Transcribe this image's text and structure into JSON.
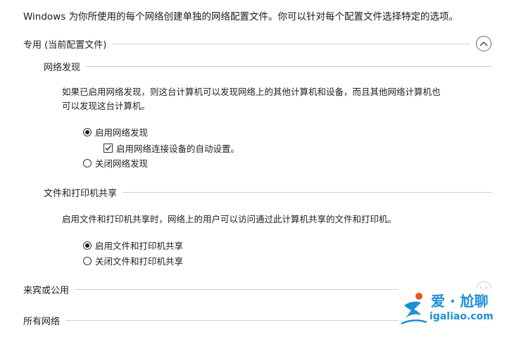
{
  "intro_text": "Windows 为你所使用的每个网络创建单独的网络配置文件。你可以针对每个配置文件选择特定的选项。",
  "profiles": {
    "private": {
      "title": "专用 (当前配置文件)",
      "expanded": true,
      "network_discovery": {
        "title": "网络发现",
        "description_line1": "如果已启用网络发现，则这台计算机可以发现网络上的其他计算机和设备，而且其他网络计算机也",
        "description_line2": "可以发现这台计算机。",
        "option_on": "启用网络发现",
        "auto_setup": "启用网络连接设备的自动设置。",
        "option_off": "关闭网络发现",
        "selected": "on",
        "auto_setup_checked": true
      },
      "file_sharing": {
        "title": "文件和打印机共享",
        "description": "启用文件和打印机共享时，网络上的用户可以访问通过此计算机共享的文件和打印机。",
        "option_on": "启用文件和打印机共享",
        "option_off": "关闭文件和打印机共享",
        "selected": "on"
      }
    },
    "guest_public": {
      "title": "来宾或公用",
      "expanded": false
    },
    "all_networks": {
      "title": "所有网络",
      "expanded": false
    }
  },
  "watermark": {
    "brand": "爱 · 尬聊",
    "url": "igaliao.com",
    "color": "#1d8fd8",
    "accent": "#e8561f"
  }
}
